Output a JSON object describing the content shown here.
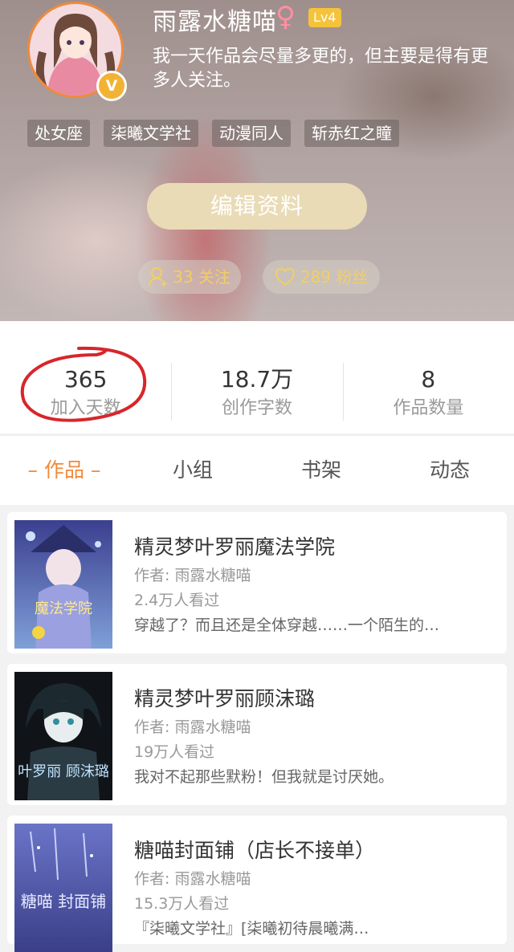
{
  "profile": {
    "name": "雨露水糖喵",
    "gender_icon": "♀",
    "level": "Lv4",
    "vip_badge": "V",
    "bio": "我一天作品会尽量多更的，但主要是得有更多人关注。",
    "tags": [
      "处女座",
      "柒曦文学社",
      "动漫同人",
      "斩赤红之瞳"
    ],
    "edit_button": "编辑资料",
    "following": "33 关注",
    "fans": "289 粉丝"
  },
  "stats": [
    {
      "value": "365",
      "label": "加入天数"
    },
    {
      "value": "18.7万",
      "label": "创作字数"
    },
    {
      "value": "8",
      "label": "作品数量"
    }
  ],
  "tabs": [
    "– 作品 –",
    "小组",
    "书架",
    "动态"
  ],
  "books": [
    {
      "title": "精灵梦叶罗丽魔法学院",
      "author": "作者: 雨露水糖喵",
      "views": "2.4万人看过",
      "desc": "穿越了？而且还是全体穿越……一个陌生的…",
      "cover_text": "魔法学院"
    },
    {
      "title": "精灵梦叶罗丽顾沫璐",
      "author": "作者: 雨露水糖喵",
      "views": "19万人看过",
      "desc": "我对不起那些默粉！但我就是讨厌她。",
      "cover_text": "叶罗丽 顾沫璐"
    },
    {
      "title": "糖喵封面铺（店长不接单）",
      "author": "作者: 雨露水糖喵",
      "views": "15.3万人看过",
      "desc": "『柒曦文学社』[柒曦初待晨曦满…",
      "cover_text": "糖喵 封面铺"
    }
  ],
  "colors": {
    "accent": "#f08a3c",
    "level_badge": "#f5c33b",
    "edit_button": "#e9dbb6",
    "annotation_circle": "#d8262b"
  }
}
